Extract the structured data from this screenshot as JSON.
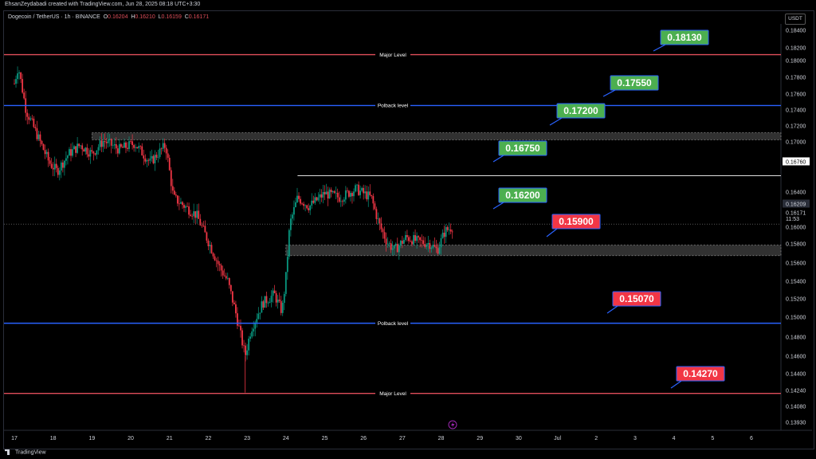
{
  "header": {
    "attribution": "EhsanZeydabadi created with TradingView.com, Jun 28, 2025 08:18 UTC+3:30"
  },
  "symbol_bar": {
    "symbol": "Dogecoin / TetherUS · 1h · BINANCE",
    "o_label": "O",
    "o_value": "0.16204",
    "h_label": "H",
    "h_value": "0.16210",
    "l_label": "L",
    "l_value": "0.16159",
    "c_label": "C",
    "c_value": "0.16171"
  },
  "currency_unit": "USDT",
  "footer": {
    "brand": "TradingView"
  },
  "colors": {
    "up": "#089981",
    "down": "#f23645",
    "red_line": "#e04e5a",
    "blue_line": "#2962ff",
    "callout_green": "#4caf50",
    "callout_red": "#f23645"
  },
  "chart_data": {
    "type": "candlestick",
    "instrument": "Dogecoin / TetherUS",
    "interval": "1h",
    "exchange": "BINANCE",
    "ohlc_last": {
      "open": 0.16204,
      "high": 0.1621,
      "low": 0.16159,
      "close": 0.16171
    },
    "y_ticks": [
      "0.18400",
      "0.18200",
      "0.18000",
      "0.17800",
      "0.17600",
      "0.17400",
      "0.17200",
      "0.17000",
      "0.16760",
      "0.16400",
      "0.16209",
      "0.16171",
      "0.16000",
      "0.15800",
      "0.15600",
      "0.15400",
      "0.15200",
      "0.15000",
      "0.14800",
      "0.14600",
      "0.14400",
      "0.14240",
      "0.14080",
      "0.13930"
    ],
    "x_ticks": [
      "17",
      "18",
      "19",
      "20",
      "21",
      "22",
      "23",
      "24",
      "25",
      "26",
      "27",
      "28",
      "29",
      "30",
      "Jul",
      "2",
      "3",
      "4",
      "5",
      "6"
    ],
    "ylim": [
      0.1385,
      0.1848
    ],
    "price_labels": {
      "resistance_top": "0.16760",
      "current_open": "0.16209",
      "current_close": "0.16171",
      "countdown": "11:53"
    },
    "levels": [
      {
        "price": 0.1813,
        "label": "Major Level",
        "color": "#e04e5a",
        "callout": "0.18130",
        "callout_color": "green"
      },
      {
        "price": 0.1755,
        "label": "Polback level",
        "color": "#2962ff",
        "callout": "0.17550",
        "callout_color": "green"
      },
      {
        "price": 0.172,
        "label": "",
        "color": "zone",
        "callout": "0.17200",
        "callout_color": "green"
      },
      {
        "price": 0.1675,
        "label": "",
        "color": "#ffffff",
        "callout": "0.16750",
        "callout_color": "green"
      },
      {
        "price": 0.162,
        "label": "",
        "color": "#888888",
        "callout": "0.16200",
        "callout_color": "green"
      },
      {
        "price": 0.159,
        "label": "",
        "color": "zone",
        "callout": "0.15900",
        "callout_color": "red"
      },
      {
        "price": 0.1507,
        "label": "Polback level",
        "color": "#2962ff",
        "callout": "0.15070",
        "callout_color": "red"
      },
      {
        "price": 0.1427,
        "label": "Major Level",
        "color": "#e04e5a",
        "callout": "0.14270",
        "callout_color": "red"
      }
    ],
    "zones": [
      {
        "from": 0.1716,
        "to": 0.1724,
        "start_day": 19.0
      },
      {
        "from": 0.1584,
        "to": 0.1596,
        "start_day": 24.0
      }
    ],
    "price_path_days": [
      17.0,
      17.1,
      17.3,
      17.6,
      17.9,
      18.1,
      18.4,
      18.7,
      19.0,
      19.3,
      19.7,
      20.1,
      20.5,
      20.9,
      21.1,
      21.4,
      21.7,
      22.0,
      22.3,
      22.5,
      22.7,
      22.95,
      23.1,
      23.4,
      23.7,
      23.9,
      24.0,
      24.1,
      24.3,
      24.6,
      25.0,
      25.4,
      25.8,
      26.2,
      26.4,
      26.6,
      26.8,
      27.1,
      27.4,
      27.7,
      27.9,
      28.1,
      28.3
    ],
    "price_path_values": [
      0.178,
      0.18,
      0.175,
      0.172,
      0.169,
      0.168,
      0.17,
      0.171,
      0.17,
      0.1715,
      0.1705,
      0.1712,
      0.169,
      0.171,
      0.165,
      0.164,
      0.163,
      0.16,
      0.157,
      0.1555,
      0.152,
      0.147,
      0.15,
      0.153,
      0.154,
      0.152,
      0.156,
      0.162,
      0.165,
      0.164,
      0.1655,
      0.165,
      0.166,
      0.165,
      0.162,
      0.16,
      0.159,
      0.1605,
      0.16,
      0.1598,
      0.159,
      0.1612,
      0.1617
    ]
  }
}
